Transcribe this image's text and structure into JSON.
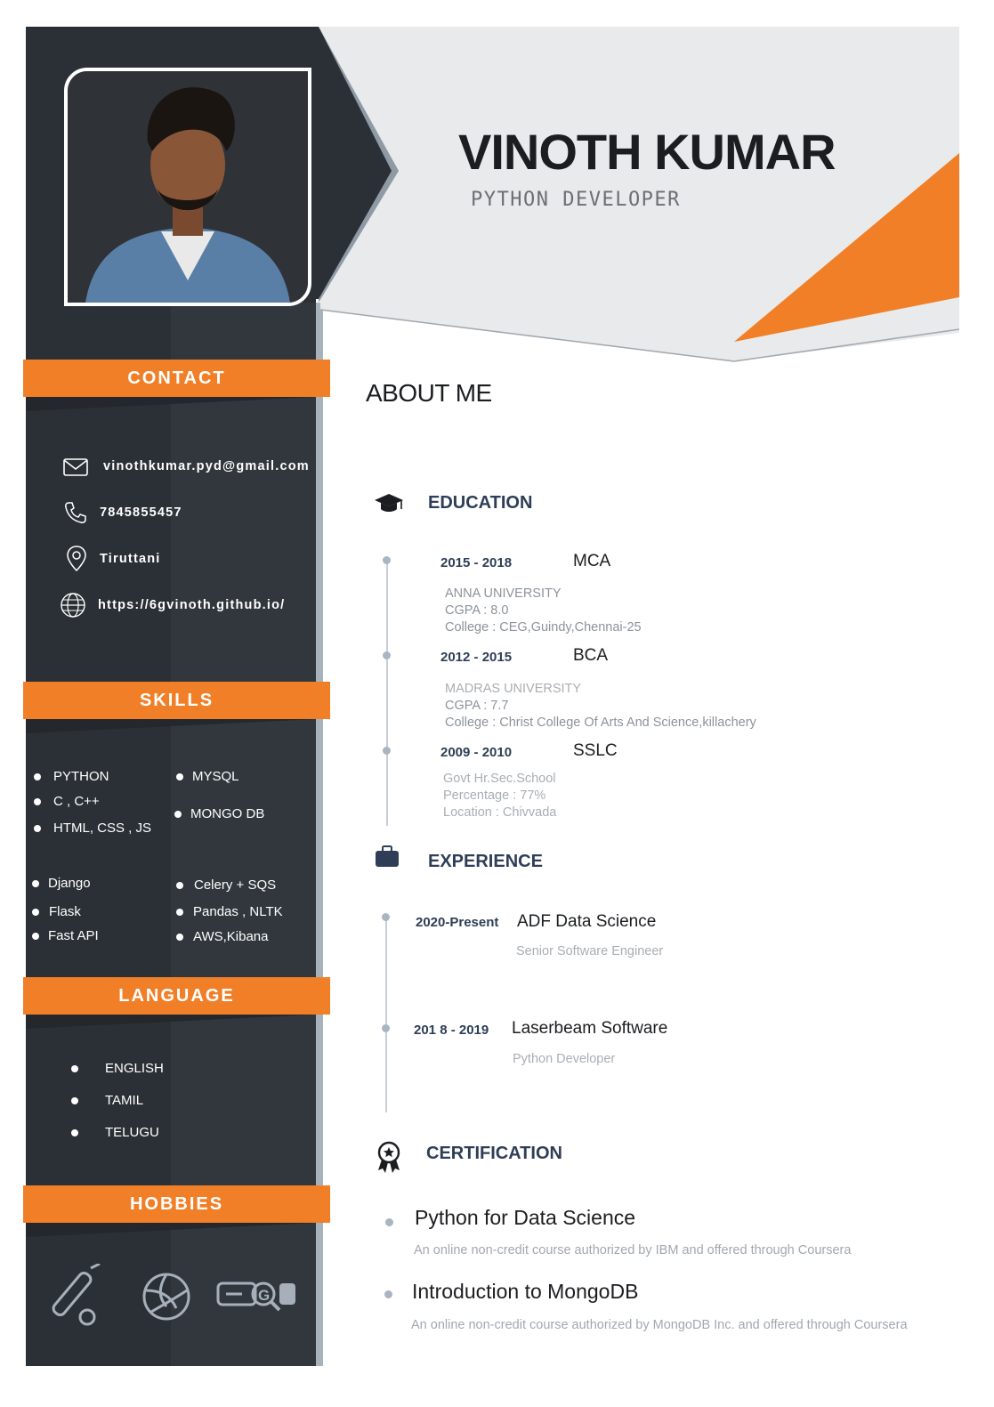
{
  "header": {
    "name": "VINOTH KUMAR",
    "role": "PYTHON DEVELOPER"
  },
  "colors": {
    "accent": "#f07f27",
    "sidebar": "#2b3036",
    "heading": "#2e3e56",
    "header_bg": "#e8eaeb"
  },
  "photo": {
    "alt": "profile-photo"
  },
  "contact": {
    "title": "CONTACT",
    "email": "vinothkumar.pyd@gmail.com",
    "phone": "7845855457",
    "location": "Tiruttani",
    "website": "https://6gvinoth.github.io/"
  },
  "skills": {
    "title": "SKILLS",
    "col1": [
      "PYTHON",
      "C , C++",
      "HTML, CSS , JS"
    ],
    "col2": [
      "MYSQL",
      "MONGO DB"
    ],
    "col3": [
      "Django",
      "Flask",
      "Fast API"
    ],
    "col4": [
      "Celery + SQS",
      "Pandas , NLTK",
      "AWS,Kibana"
    ]
  },
  "language": {
    "title": "LANGUAGE",
    "items": [
      "ENGLISH",
      "TAMIL",
      "TELUGU"
    ]
  },
  "hobbies": {
    "title": "HOBBIES",
    "icons": [
      "cricket-icon",
      "volleyball-icon",
      "gaming-icon"
    ]
  },
  "about": {
    "title": "ABOUT ME"
  },
  "education": {
    "title": "EDUCATION",
    "items": [
      {
        "years": "2015 - 2018",
        "degree": "MCA",
        "lines": [
          "ANNA UNIVERSITY",
          "CGPA : 8.0",
          "College : CEG,Guindy,Chennai-25"
        ]
      },
      {
        "years": "2012 - 2015",
        "degree": "BCA",
        "lines": [
          "MADRAS UNIVERSITY",
          "CGPA : 7.7",
          "College : Christ College Of Arts And Science,killachery"
        ]
      },
      {
        "years": "2009 - 2010",
        "degree": "SSLC",
        "lines": [
          "Govt Hr.Sec.School",
          "Percentage : 77%",
          "Location : Chivvada"
        ]
      }
    ]
  },
  "experience": {
    "title": "EXPERIENCE",
    "items": [
      {
        "years": "2020-Present",
        "company": "ADF Data Science",
        "position": "Senior Software Engineer"
      },
      {
        "years": "201 8 - 2019",
        "company": "Laserbeam Software",
        "position": "Python Developer"
      }
    ]
  },
  "certification": {
    "title": "CERTIFICATION",
    "items": [
      {
        "title": "Python for Data Science",
        "desc": "An online non-credit course authorized by IBM and offered through Coursera"
      },
      {
        "title": "Introduction to MongoDB",
        "desc": "An online non-credit course authorized by MongoDB Inc. and offered through Coursera"
      }
    ]
  }
}
